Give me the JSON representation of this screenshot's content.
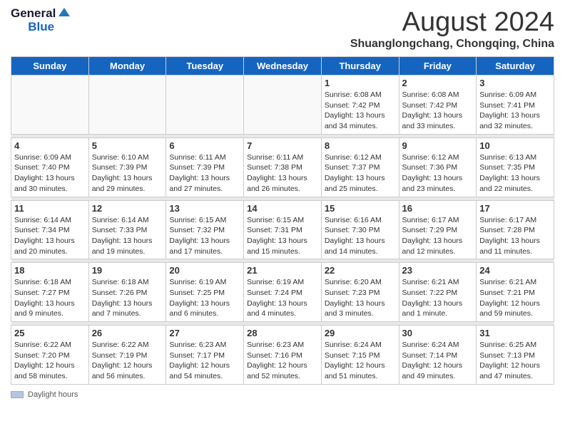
{
  "header": {
    "logo_line1": "General",
    "logo_line2": "Blue",
    "month_title": "August 2024",
    "location": "Shuanglongchang, Chongqing, China"
  },
  "weekdays": [
    "Sunday",
    "Monday",
    "Tuesday",
    "Wednesday",
    "Thursday",
    "Friday",
    "Saturday"
  ],
  "weeks": [
    [
      {
        "day": "",
        "info": ""
      },
      {
        "day": "",
        "info": ""
      },
      {
        "day": "",
        "info": ""
      },
      {
        "day": "",
        "info": ""
      },
      {
        "day": "1",
        "info": "Sunrise: 6:08 AM\nSunset: 7:42 PM\nDaylight: 13 hours\nand 34 minutes."
      },
      {
        "day": "2",
        "info": "Sunrise: 6:08 AM\nSunset: 7:42 PM\nDaylight: 13 hours\nand 33 minutes."
      },
      {
        "day": "3",
        "info": "Sunrise: 6:09 AM\nSunset: 7:41 PM\nDaylight: 13 hours\nand 32 minutes."
      }
    ],
    [
      {
        "day": "4",
        "info": "Sunrise: 6:09 AM\nSunset: 7:40 PM\nDaylight: 13 hours\nand 30 minutes."
      },
      {
        "day": "5",
        "info": "Sunrise: 6:10 AM\nSunset: 7:39 PM\nDaylight: 13 hours\nand 29 minutes."
      },
      {
        "day": "6",
        "info": "Sunrise: 6:11 AM\nSunset: 7:39 PM\nDaylight: 13 hours\nand 27 minutes."
      },
      {
        "day": "7",
        "info": "Sunrise: 6:11 AM\nSunset: 7:38 PM\nDaylight: 13 hours\nand 26 minutes."
      },
      {
        "day": "8",
        "info": "Sunrise: 6:12 AM\nSunset: 7:37 PM\nDaylight: 13 hours\nand 25 minutes."
      },
      {
        "day": "9",
        "info": "Sunrise: 6:12 AM\nSunset: 7:36 PM\nDaylight: 13 hours\nand 23 minutes."
      },
      {
        "day": "10",
        "info": "Sunrise: 6:13 AM\nSunset: 7:35 PM\nDaylight: 13 hours\nand 22 minutes."
      }
    ],
    [
      {
        "day": "11",
        "info": "Sunrise: 6:14 AM\nSunset: 7:34 PM\nDaylight: 13 hours\nand 20 minutes."
      },
      {
        "day": "12",
        "info": "Sunrise: 6:14 AM\nSunset: 7:33 PM\nDaylight: 13 hours\nand 19 minutes."
      },
      {
        "day": "13",
        "info": "Sunrise: 6:15 AM\nSunset: 7:32 PM\nDaylight: 13 hours\nand 17 minutes."
      },
      {
        "day": "14",
        "info": "Sunrise: 6:15 AM\nSunset: 7:31 PM\nDaylight: 13 hours\nand 15 minutes."
      },
      {
        "day": "15",
        "info": "Sunrise: 6:16 AM\nSunset: 7:30 PM\nDaylight: 13 hours\nand 14 minutes."
      },
      {
        "day": "16",
        "info": "Sunrise: 6:17 AM\nSunset: 7:29 PM\nDaylight: 13 hours\nand 12 minutes."
      },
      {
        "day": "17",
        "info": "Sunrise: 6:17 AM\nSunset: 7:28 PM\nDaylight: 13 hours\nand 11 minutes."
      }
    ],
    [
      {
        "day": "18",
        "info": "Sunrise: 6:18 AM\nSunset: 7:27 PM\nDaylight: 13 hours\nand 9 minutes."
      },
      {
        "day": "19",
        "info": "Sunrise: 6:18 AM\nSunset: 7:26 PM\nDaylight: 13 hours\nand 7 minutes."
      },
      {
        "day": "20",
        "info": "Sunrise: 6:19 AM\nSunset: 7:25 PM\nDaylight: 13 hours\nand 6 minutes."
      },
      {
        "day": "21",
        "info": "Sunrise: 6:19 AM\nSunset: 7:24 PM\nDaylight: 13 hours\nand 4 minutes."
      },
      {
        "day": "22",
        "info": "Sunrise: 6:20 AM\nSunset: 7:23 PM\nDaylight: 13 hours\nand 3 minutes."
      },
      {
        "day": "23",
        "info": "Sunrise: 6:21 AM\nSunset: 7:22 PM\nDaylight: 13 hours\nand 1 minute."
      },
      {
        "day": "24",
        "info": "Sunrise: 6:21 AM\nSunset: 7:21 PM\nDaylight: 12 hours\nand 59 minutes."
      }
    ],
    [
      {
        "day": "25",
        "info": "Sunrise: 6:22 AM\nSunset: 7:20 PM\nDaylight: 12 hours\nand 58 minutes."
      },
      {
        "day": "26",
        "info": "Sunrise: 6:22 AM\nSunset: 7:19 PM\nDaylight: 12 hours\nand 56 minutes."
      },
      {
        "day": "27",
        "info": "Sunrise: 6:23 AM\nSunset: 7:17 PM\nDaylight: 12 hours\nand 54 minutes."
      },
      {
        "day": "28",
        "info": "Sunrise: 6:23 AM\nSunset: 7:16 PM\nDaylight: 12 hours\nand 52 minutes."
      },
      {
        "day": "29",
        "info": "Sunrise: 6:24 AM\nSunset: 7:15 PM\nDaylight: 12 hours\nand 51 minutes."
      },
      {
        "day": "30",
        "info": "Sunrise: 6:24 AM\nSunset: 7:14 PM\nDaylight: 12 hours\nand 49 minutes."
      },
      {
        "day": "31",
        "info": "Sunrise: 6:25 AM\nSunset: 7:13 PM\nDaylight: 12 hours\nand 47 minutes."
      }
    ]
  ],
  "legend": {
    "box_label": "Daylight hours"
  }
}
